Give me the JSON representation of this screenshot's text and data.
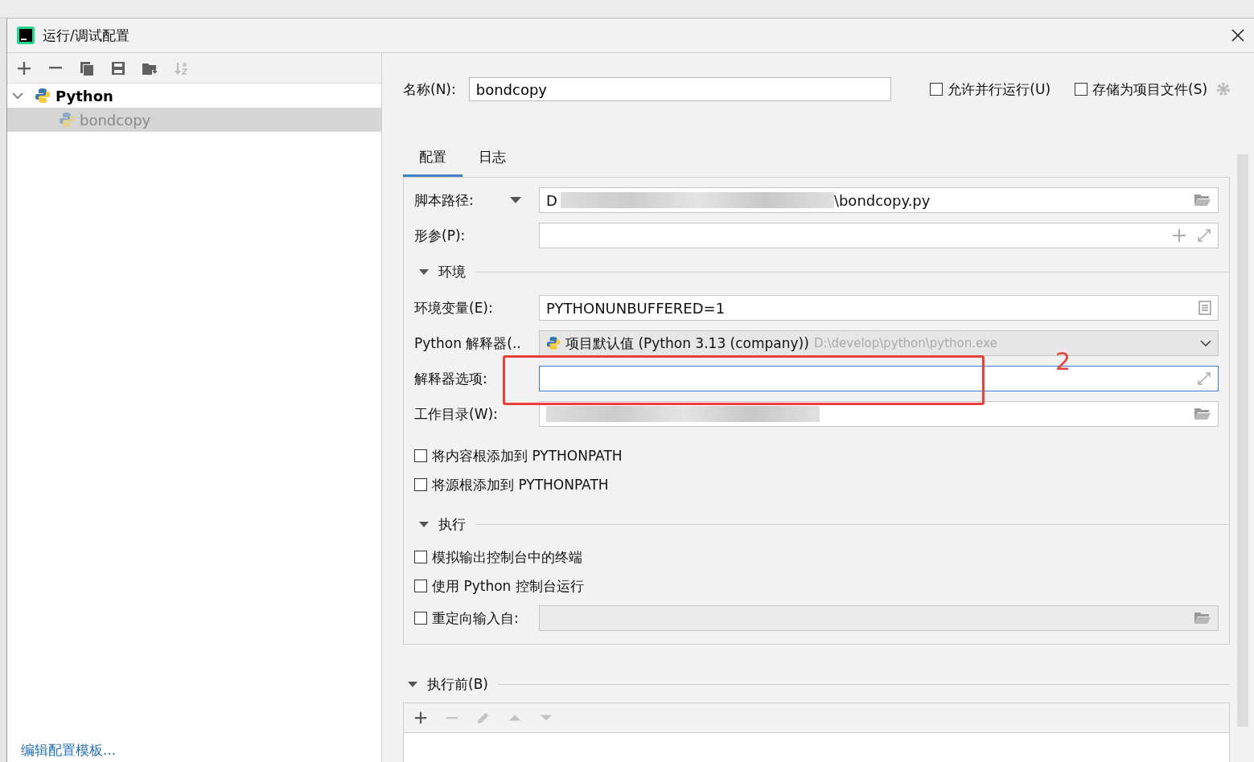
{
  "window": {
    "title": "运行/调试配置"
  },
  "toolbar": [
    {
      "kind": "add",
      "disabled": false
    },
    {
      "kind": "remove",
      "disabled": false
    },
    {
      "kind": "copy",
      "disabled": false
    },
    {
      "kind": "save",
      "disabled": false
    },
    {
      "kind": "folder-add",
      "disabled": false
    },
    {
      "kind": "sort",
      "disabled": true
    }
  ],
  "tree": [
    {
      "label": "Python",
      "expanded": true,
      "children": [
        {
          "label": "bondcopy",
          "selected": true
        }
      ]
    }
  ],
  "edit_templates_link": "编辑配置模板...",
  "name": {
    "label": "名称(N):",
    "value": "bondcopy"
  },
  "options": [
    {
      "label": "允许并行运行(U)",
      "checked": false
    },
    {
      "label": "存储为项目文件(S)",
      "checked": false
    }
  ],
  "tabs": [
    {
      "label": "配置",
      "selected": true
    },
    {
      "label": "日志",
      "selected": false
    }
  ],
  "form": [
    {
      "kind": "field",
      "label": "脚本路径:",
      "label_dropdown": true,
      "value": "D",
      "value_end": "\\bondcopy.py",
      "redacted": true,
      "buttons": [
        {
          "kind": "folder"
        }
      ]
    },
    {
      "kind": "field",
      "label": "形参(P):",
      "buttons": [
        {
          "kind": "add"
        },
        {
          "kind": "expand"
        }
      ]
    },
    {
      "kind": "section",
      "label": "环境",
      "expanded": true
    },
    {
      "kind": "field",
      "label": "环境变量(E):",
      "value": "PYTHONUNBUFFERED=1",
      "buttons": [
        {
          "kind": "list"
        }
      ]
    },
    {
      "kind": "combo",
      "label": "Python 解释器(..",
      "value": "项目默认值 (Python 3.13 (company))",
      "hint": "D:\\develop\\python\\python.exe"
    },
    {
      "kind": "field",
      "label": "解释器选项:",
      "focused": true,
      "buttons": [
        {
          "kind": "expand"
        }
      ]
    },
    {
      "kind": "field",
      "label": "工作目录(W):",
      "redacted": true,
      "buttons": [
        {
          "kind": "folder"
        }
      ]
    },
    {
      "kind": "checkbox",
      "label": "将内容根添加到 PYTHONPATH",
      "checked": false
    },
    {
      "kind": "checkbox",
      "label": "将源根添加到 PYTHONPATH",
      "checked": false
    },
    {
      "kind": "section",
      "label": "执行",
      "expanded": true
    },
    {
      "kind": "checkbox",
      "label": "模拟输出控制台中的终端",
      "checked": false
    },
    {
      "kind": "checkbox",
      "label": "使用 Python 控制台运行",
      "checked": false
    },
    {
      "kind": "field",
      "label": "重定向输入自:",
      "checked": false,
      "disabled": true,
      "buttons": [
        {
          "kind": "folder"
        }
      ]
    }
  ],
  "before_launch": {
    "title": "执行前(B)",
    "expanded": true,
    "tools": [
      {
        "kind": "add",
        "disabled": false
      },
      {
        "kind": "remove",
        "disabled": true
      },
      {
        "kind": "edit",
        "disabled": true
      },
      {
        "kind": "up",
        "disabled": true
      },
      {
        "kind": "down",
        "disabled": true
      }
    ]
  },
  "annotation": {
    "label": "2"
  }
}
